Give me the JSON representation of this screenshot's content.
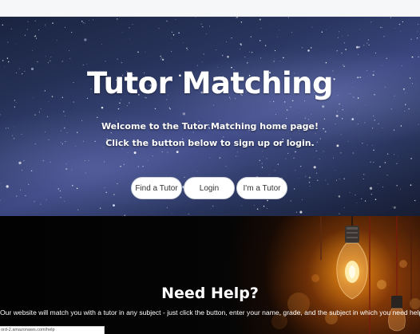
{
  "hero": {
    "title": "Tutor Matching",
    "line1": "Welcome to the Tutor Matching home page!",
    "line2": "Click the button below to sign up or login.",
    "buttons": [
      {
        "label": "Find a Tutor"
      },
      {
        "label": "Login"
      },
      {
        "label": "I'm a Tutor"
      }
    ]
  },
  "help": {
    "title": "Need Help?",
    "description": "Our website will match you with a tutor in any subject - just click the button, enter your name, grade, and the subject in which you need help."
  },
  "status_bar": {
    "url": "ord-2.amazonaws.com/help"
  },
  "colors": {
    "button_bg": "#ffffff",
    "text_on_dark": "#ffffff",
    "glow": "#ffb040"
  }
}
